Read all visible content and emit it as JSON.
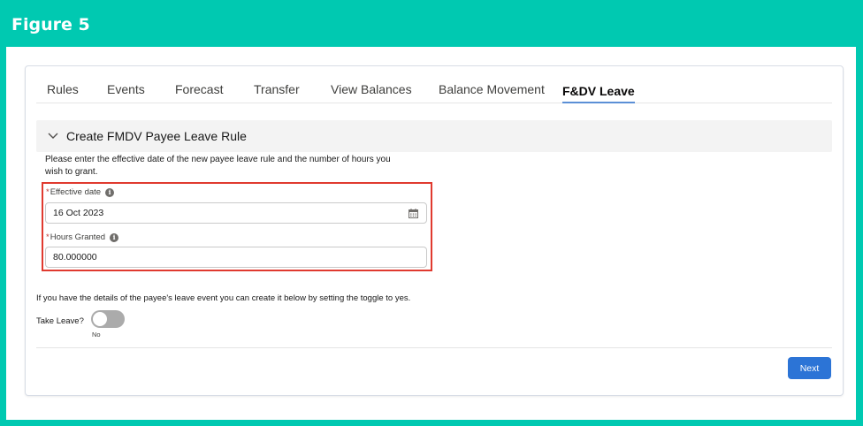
{
  "figure_title": "Figure 5",
  "colors": {
    "frame": "#00c9b1",
    "highlight_border": "#e03a2f",
    "active_tab_underline": "#5b8fd6",
    "primary_button": "#2c74d6"
  },
  "tabs": [
    {
      "label": "Rules"
    },
    {
      "label": "Events"
    },
    {
      "label": "Forecast"
    },
    {
      "label": "Transfer"
    },
    {
      "label": "View Balances"
    },
    {
      "label": "Balance Movement"
    },
    {
      "label": "F&DV Leave",
      "active": true
    }
  ],
  "section": {
    "title": "Create FMDV Payee Leave Rule",
    "expanded": true,
    "intro_line1": "Please enter the effective date of the new payee leave rule and the number of hours you",
    "intro_line2": "wish to grant."
  },
  "fields": {
    "effective_date": {
      "required_mark": "*",
      "label": "Effective date",
      "value": "16 Oct 2023",
      "icon": "calendar-icon"
    },
    "hours_granted": {
      "required_mark": "*",
      "label": "Hours Granted",
      "value": "80.000000"
    }
  },
  "leave_toggle": {
    "note": "If you have the details of the payee's leave event you can create it below by setting the toggle to yes.",
    "label": "Take Leave?",
    "state": "No",
    "on": false
  },
  "actions": {
    "next_label": "Next"
  }
}
